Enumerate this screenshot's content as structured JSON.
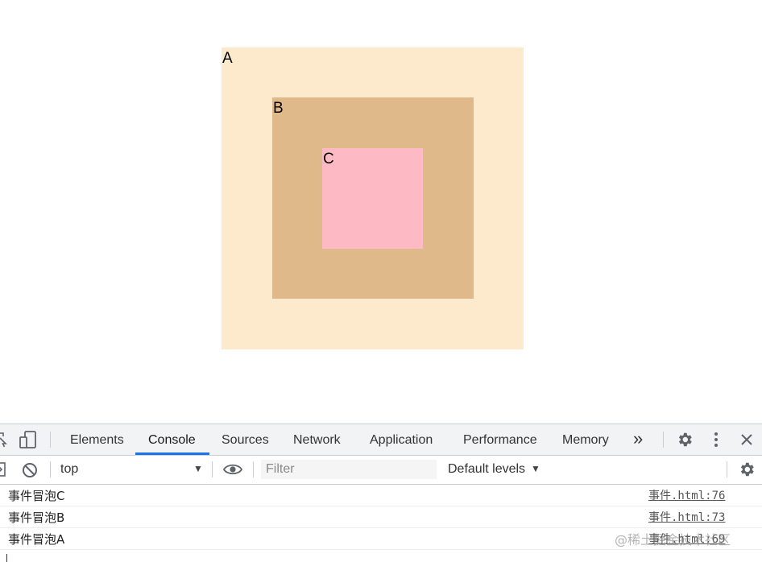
{
  "page": {
    "boxes": [
      {
        "label": "A",
        "color": "#fdeacd"
      },
      {
        "label": "B",
        "color": "#dfb98a"
      },
      {
        "label": "C",
        "color": "#fdbac4"
      }
    ]
  },
  "devtools": {
    "tabs": [
      {
        "label": "Elements"
      },
      {
        "label": "Console",
        "active": true
      },
      {
        "label": "Sources"
      },
      {
        "label": "Network"
      },
      {
        "label": "Application"
      },
      {
        "label": "Performance"
      },
      {
        "label": "Memory"
      }
    ],
    "more_tabs_glyph": "»",
    "icons": [
      "inspect-icon",
      "device-toolbar-icon",
      "settings-gear-icon",
      "more-vertical-icon",
      "close-icon",
      "sidebar-toggle-icon",
      "clear-console-icon",
      "live-expression-eye-icon",
      "console-settings-gear-icon"
    ],
    "toolbar": {
      "context": "top",
      "filter_placeholder": "Filter",
      "levels": "Default levels"
    },
    "messages": [
      {
        "text": "事件冒泡C",
        "source": "事件.html:76"
      },
      {
        "text": "事件冒泡B",
        "source": "事件.html:73"
      },
      {
        "text": "事件冒泡A",
        "source": "事件.html:69"
      }
    ],
    "accent_color": "#1a73e8"
  },
  "watermark": "@稀土掘金技术社区"
}
